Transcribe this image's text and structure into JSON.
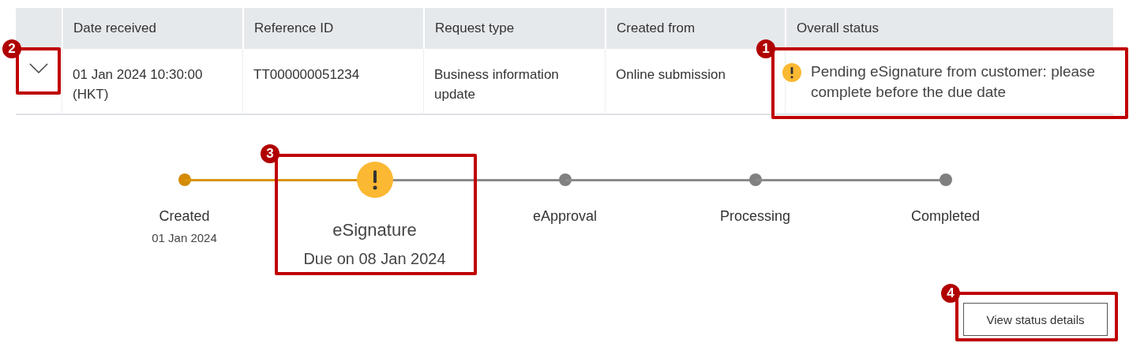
{
  "table": {
    "columns": [
      "Date received",
      "Reference ID",
      "Request type",
      "Created from",
      "Overall status"
    ],
    "rows": [
      {
        "expanded": true,
        "date_received": "01 Jan 2024 10:30:00 (HKT)",
        "reference_id": "TT000000051234",
        "request_type": "Business information update",
        "created_from": "Online submission",
        "overall_status": "Pending eSignature from customer: please complete before the due date"
      }
    ]
  },
  "stepper": [
    {
      "label": "Created",
      "date": "01 Jan 2024",
      "kind": "done"
    },
    {
      "label": "eSignature",
      "date": "Due on 08 Jan 2024",
      "kind": "current"
    },
    {
      "label": "eApproval",
      "kind": "pending"
    },
    {
      "label": "Processing",
      "kind": "pending"
    },
    {
      "label": "Completed",
      "kind": "pending"
    }
  ],
  "button": "View status details",
  "annotations": [
    {
      "number": "1"
    },
    {
      "number": "2"
    },
    {
      "number": "3"
    },
    {
      "number": "4"
    }
  ]
}
